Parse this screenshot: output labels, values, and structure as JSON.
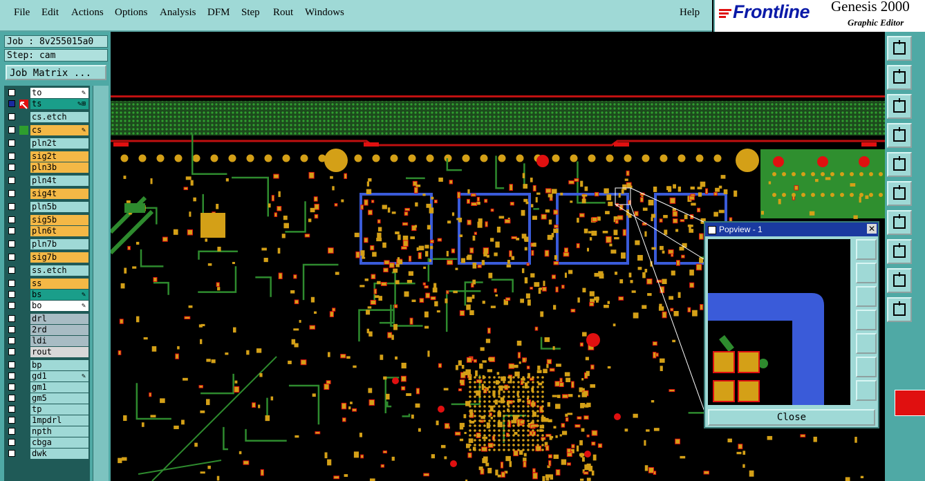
{
  "menu": {
    "items": [
      "File",
      "Edit",
      "Actions",
      "Options",
      "Analysis",
      "DFM",
      "Step",
      "Rout",
      "Windows"
    ],
    "help": "Help"
  },
  "branding": {
    "brand": "Frontline",
    "product": "Genesis 2000",
    "subtitle": "Graphic Editor"
  },
  "job": {
    "job_label": "Job : 8v255015a0",
    "step_label": "Step: cam",
    "matrix_button": "Job Matrix ..."
  },
  "layers": [
    {
      "name": "to",
      "color": "#ffffff",
      "tag": "✎"
    },
    {
      "name": "ts",
      "color": "#1a9e8a",
      "tag": "✎⊞",
      "active": true
    },
    {
      "name": "cs.etch",
      "color": "#9fd9d6",
      "tag": ""
    },
    {
      "name": "cs",
      "color": "#f4b846",
      "tag": "✎"
    },
    {
      "name": "pln2t",
      "color": "#9fd9d6",
      "tag": ""
    },
    {
      "name": "sig2t",
      "color": "#f4b846",
      "tag": ""
    },
    {
      "name": "pln3b",
      "color": "#f4b846",
      "tag": ""
    },
    {
      "name": "pln4t",
      "color": "#9fd9d6",
      "tag": ""
    },
    {
      "name": "sig4t",
      "color": "#f4b846",
      "tag": ""
    },
    {
      "name": "pln5b",
      "color": "#9fd9d6",
      "tag": ""
    },
    {
      "name": "sig5b",
      "color": "#f4b846",
      "tag": ""
    },
    {
      "name": "pln6t",
      "color": "#f4b846",
      "tag": ""
    },
    {
      "name": "pln7b",
      "color": "#9fd9d6",
      "tag": ""
    },
    {
      "name": "sig7b",
      "color": "#f4b846",
      "tag": ""
    },
    {
      "name": "ss.etch",
      "color": "#9fd9d6",
      "tag": ""
    },
    {
      "name": "ss",
      "color": "#f4b846",
      "tag": ""
    },
    {
      "name": "bs",
      "color": "#1a9e8a",
      "tag": "✎"
    },
    {
      "name": "bo",
      "color": "#ffffff",
      "tag": "✎"
    },
    {
      "name": "drl",
      "color": "#a8bcc4",
      "tag": ""
    },
    {
      "name": "2rd",
      "color": "#a8bcc4",
      "tag": ""
    },
    {
      "name": "ldi",
      "color": "#a8bcc4",
      "tag": ""
    },
    {
      "name": "rout",
      "color": "#d8d8d8",
      "tag": ""
    },
    {
      "name": "bp",
      "color": "#9fd9d6",
      "tag": ""
    },
    {
      "name": "gd1",
      "color": "#9fd9d6",
      "tag": "✎"
    },
    {
      "name": "gm1",
      "color": "#9fd9d6",
      "tag": ""
    },
    {
      "name": "gm5",
      "color": "#9fd9d6",
      "tag": ""
    },
    {
      "name": "tp",
      "color": "#9fd9d6",
      "tag": ""
    },
    {
      "name": "1mpdrl",
      "color": "#9fd9d6",
      "tag": ""
    },
    {
      "name": "npth",
      "color": "#9fd9d6",
      "tag": ""
    },
    {
      "name": "cbga",
      "color": "#9fd9d6",
      "tag": ""
    },
    {
      "name": "dwk",
      "color": "#9fd9d6",
      "tag": ""
    }
  ],
  "popview": {
    "title": "Popview - 1",
    "close_label": "Close"
  },
  "colors": {
    "ui_bg": "#9fd9d6",
    "pcb_pad": "#d4a017",
    "pcb_trace": "#2e8b2e",
    "pcb_highlight": "#3a5bd9",
    "pcb_red": "#e01010"
  }
}
